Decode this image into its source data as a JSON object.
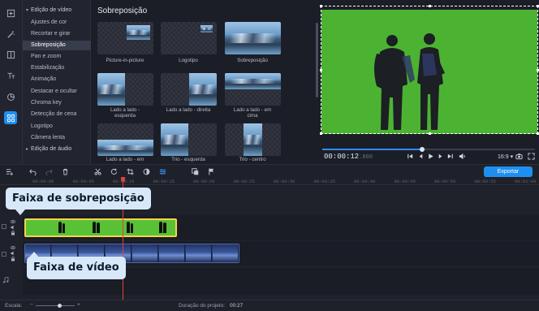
{
  "rail": {
    "icons": [
      "import-icon",
      "magic-wand-icon",
      "transitions-icon",
      "text-icon",
      "stickers-icon",
      "more-tools-icon"
    ]
  },
  "categories": [
    {
      "label": "Edição de vídeo",
      "group": true
    },
    {
      "label": "Ajustes de cor"
    },
    {
      "label": "Recortar e girar"
    },
    {
      "label": "Sobreposição",
      "active": true
    },
    {
      "label": "Pan e zoom"
    },
    {
      "label": "Estabilização"
    },
    {
      "label": "Animação"
    },
    {
      "label": "Destacar e ocultar"
    },
    {
      "label": "Chroma key"
    },
    {
      "label": "Detecção de cena"
    },
    {
      "label": "Logotipo"
    },
    {
      "label": "Câmera lenta"
    },
    {
      "label": "Edição de áudio",
      "group": true
    }
  ],
  "library": {
    "title": "Sobreposição",
    "items": [
      {
        "label": "Picture-in-picture"
      },
      {
        "label": "Logotipo"
      },
      {
        "label": "Sobreposição"
      },
      {
        "label": "Lado a lado -\nesquerda"
      },
      {
        "label": "Lado a lado - direita"
      },
      {
        "label": "Lado a lado - em\ncima"
      },
      {
        "label": "Lado a lado - em"
      },
      {
        "label": "Trio - esquerda"
      },
      {
        "label": "Trio - centro"
      }
    ]
  },
  "preview": {
    "timecode": "00:00:12",
    "timecode_ms": ".800",
    "progress": 0.47,
    "aspect_ratio": "16:9 ▾",
    "background_color": "#4cb332"
  },
  "toolbar": {
    "export_label": "Exportar",
    "tools": [
      "undo-icon",
      "redo-icon",
      "delete-icon",
      "cut-icon",
      "rotate-icon",
      "crop-icon",
      "color-icon",
      "adjust-icon",
      "overlay-icon",
      "marker-icon"
    ]
  },
  "ruler": {
    "ticks": [
      "00:00:00",
      "00:00:05",
      "00:00:10",
      "00:00:15",
      "00:00:20",
      "00:00:25",
      "00:00:30",
      "00:00:35",
      "00:00:40",
      "00:00:45",
      "00:00:50",
      "00:00:55",
      "00:01:00"
    ]
  },
  "timeline": {
    "playhead_time": "00:00:12"
  },
  "callouts": {
    "overlay_track": "Faixa de sobreposição",
    "video_track": "Faixa de vídeo"
  },
  "status": {
    "scale_label": "Escala:",
    "zoom_level": 0.6,
    "duration_label": "Duração do projeto:",
    "duration_value": "00:27"
  }
}
